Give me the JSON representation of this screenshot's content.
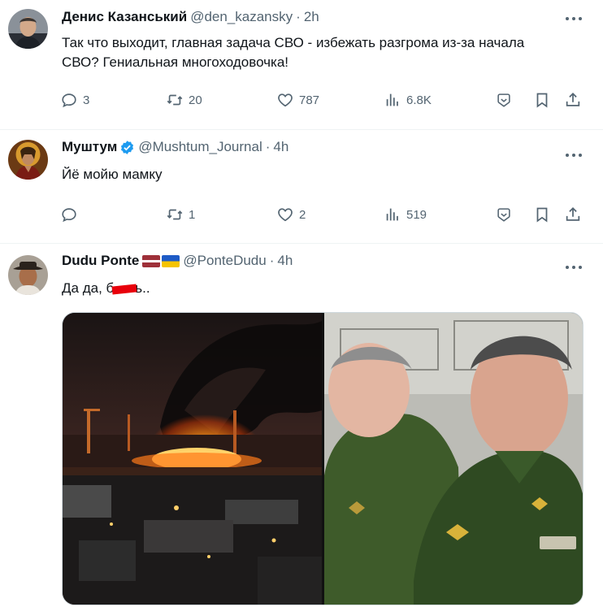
{
  "tweets": [
    {
      "name": "Денис Казанський",
      "handle": "@den_kazansky",
      "time": "2h",
      "text_line1": "Так что выходит, главная задача СВО - избежать разгрома из-за начала",
      "text_line2": "СВО? Гениальная многоходовочка!",
      "replies": "3",
      "retweets": "20",
      "likes": "787",
      "views": "6.8K"
    },
    {
      "name": "Муштум",
      "handle": "@Mushtum_Journal",
      "time": "4h",
      "text_line1": "Йё мойю мамку",
      "replies": "",
      "retweets": "1",
      "likes": "2",
      "views": "519"
    },
    {
      "name": "Dudu Ponte",
      "handle": "@PonteDudu",
      "time": "4h",
      "text_start": "Да да, б",
      "text_end": "ь..",
      "replies": "",
      "retweets": "",
      "likes": "",
      "views": ""
    }
  ],
  "separator": "·",
  "colors": {
    "text": "#0f1419",
    "secondary": "#536471",
    "verified": "#1d9bf0",
    "border": "#eff3f4"
  },
  "icons": [
    "more-icon",
    "reply-icon",
    "retweet-icon",
    "like-icon",
    "views-icon",
    "grok-icon",
    "bookmark-icon",
    "share-icon",
    "verified-badge-icon",
    "latvia-flag-icon",
    "ukraine-flag-icon"
  ]
}
